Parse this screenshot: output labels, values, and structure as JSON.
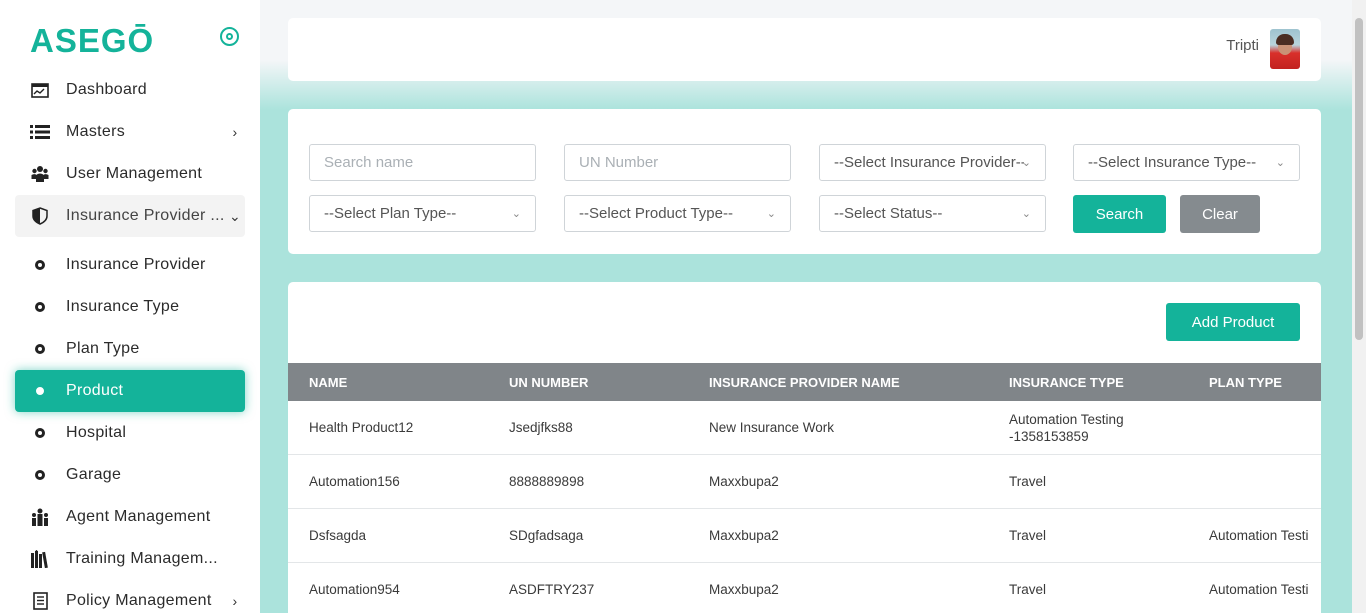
{
  "brand": {
    "logo": "ASEGŌ",
    "accent_color": "#14b39a"
  },
  "sidebar": {
    "items": [
      {
        "label": "Dashboard",
        "icon": "dashboard-icon"
      },
      {
        "label": "Masters",
        "icon": "list-icon",
        "chevron": "›"
      },
      {
        "label": "User Management",
        "icon": "users-icon"
      },
      {
        "label": "Insurance Provider ...",
        "icon": "shield-icon",
        "chevron": "⌄",
        "expanded": true
      },
      {
        "label": "Insurance Provider",
        "icon": "dot-icon"
      },
      {
        "label": "Insurance Type",
        "icon": "dot-icon"
      },
      {
        "label": "Plan Type",
        "icon": "dot-icon"
      },
      {
        "label": "Product",
        "icon": "dot-icon",
        "active": true
      },
      {
        "label": "Hospital",
        "icon": "dot-icon"
      },
      {
        "label": "Garage",
        "icon": "dot-icon"
      },
      {
        "label": "Agent Management",
        "icon": "agent-icon"
      },
      {
        "label": "Training Managem...",
        "icon": "books-icon"
      },
      {
        "label": "Policy Management",
        "icon": "document-icon",
        "chevron": "›"
      }
    ]
  },
  "header": {
    "username": "Tripti"
  },
  "filters": {
    "search_placeholder": "Search name",
    "un_placeholder": "UN Number",
    "provider": "--Select Insurance Provider--",
    "insurance_type": "--Select Insurance Type--",
    "plan_type": "--Select Plan Type--",
    "product_type": "--Select Product Type--",
    "status": "--Select Status--",
    "search_label": "Search",
    "clear_label": "Clear"
  },
  "table": {
    "add_label": "Add Product",
    "columns": [
      "NAME",
      "UN NUMBER",
      "INSURANCE PROVIDER NAME",
      "INSURANCE TYPE",
      "PLAN TYPE"
    ],
    "rows": [
      {
        "name": "Health Product12",
        "un": "Jsedjfks88",
        "provider": "New Insurance Work",
        "type_line1": "Automation Testing",
        "type_line2": "-1358153859",
        "plan": ""
      },
      {
        "name": "Automation156",
        "un": "8888889898",
        "provider": "Maxxbupa2",
        "type_line1": "Travel",
        "type_line2": "",
        "plan": ""
      },
      {
        "name": "Dsfsagda",
        "un": "SDgfadsaga",
        "provider": "Maxxbupa2",
        "type_line1": "Travel",
        "type_line2": "",
        "plan": "Automation Testi"
      },
      {
        "name": "Automation954",
        "un": "ASDFTRY237",
        "provider": "Maxxbupa2",
        "type_line1": "Travel",
        "type_line2": "",
        "plan": "Automation Testi"
      }
    ]
  }
}
